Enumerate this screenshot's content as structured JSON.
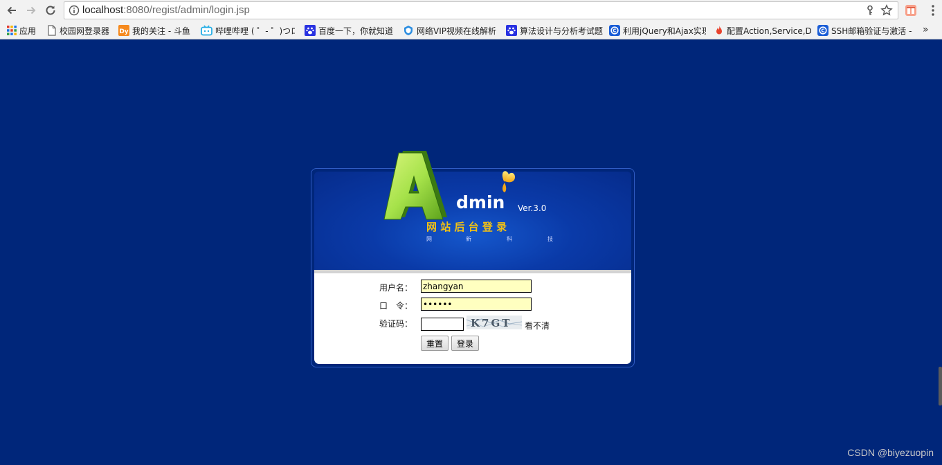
{
  "browser": {
    "url_host": "localhost",
    "url_rest": ":8080/regist/admin/login.jsp",
    "bookmarks": [
      {
        "label": "应用",
        "icon": "apps-grid-icon"
      },
      {
        "label": "校园网登录器",
        "icon": "page-icon"
      },
      {
        "label": "我的关注 - 斗鱼",
        "icon": "douyu-icon"
      },
      {
        "label": "哔哩哔哩 ( ゜- ゜)つロ",
        "icon": "bilibili-icon"
      },
      {
        "label": "百度一下，你就知道",
        "icon": "baidu-paw-icon"
      },
      {
        "label": "网络VIP视频在线解析",
        "icon": "shield-icon"
      },
      {
        "label": "算法设计与分析考试题",
        "icon": "baidu-paw-icon"
      },
      {
        "label": "利用jQuery和Ajax实现",
        "icon": "csdn-icon"
      },
      {
        "label": "配置Action,Service,D",
        "icon": "flame-icon"
      },
      {
        "label": "SSH邮箱验证与激活 -",
        "icon": "csdn-icon"
      }
    ],
    "more_label": "»"
  },
  "logo": {
    "letter": "A",
    "word": "dmin",
    "version": "Ver.3.0",
    "title": "网 站 后 台 登 录",
    "subtitle": [
      "网",
      "新",
      "科",
      "技"
    ]
  },
  "form": {
    "username_label": "用户名：",
    "username_value": "zhangyan",
    "password_label": "口　令：",
    "password_value": "123456",
    "captcha_label": "验证码：",
    "captcha_value": "",
    "captcha_text": "K7GT",
    "captcha_refresh": "看不清",
    "reset_label": "重置",
    "login_label": "登录"
  },
  "watermark": "CSDN @biyezuopin",
  "colors": {
    "page_background": "#00267a",
    "field_background": "#ffffc0",
    "title_gold": "#f2c114",
    "logo_green": "#a6e24a"
  }
}
